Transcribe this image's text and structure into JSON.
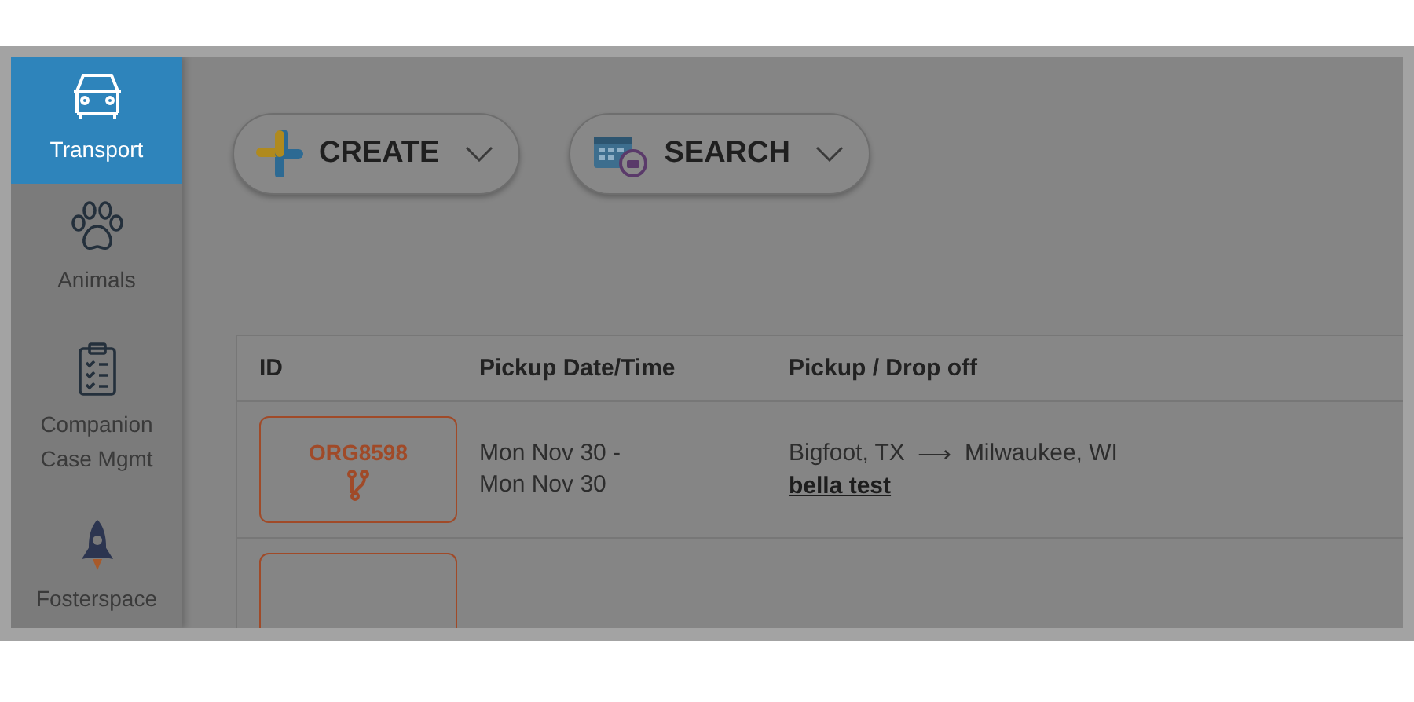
{
  "sidebar": {
    "items": [
      {
        "label": "Transport",
        "selected": true
      },
      {
        "label": "Animals",
        "selected": false
      },
      {
        "label": "Companion Case Mgmt",
        "selected": false
      },
      {
        "label": "Fosterspace",
        "selected": false
      }
    ]
  },
  "toolbar": {
    "buttons": [
      {
        "label": "CREATE"
      },
      {
        "label": "SEARCH"
      }
    ]
  },
  "table": {
    "columns": [
      "ID",
      "Pickup Date/Time",
      "Pickup / Drop off"
    ],
    "rows": [
      {
        "id": "ORG8598",
        "date_lines": [
          "Mon Nov 30 -",
          "Mon Nov 30"
        ],
        "pickup": "Bigfoot, TX",
        "arrow": "⟶",
        "dropoff": "Milwaukee, WI",
        "link": "bella test"
      },
      {}
    ]
  }
}
